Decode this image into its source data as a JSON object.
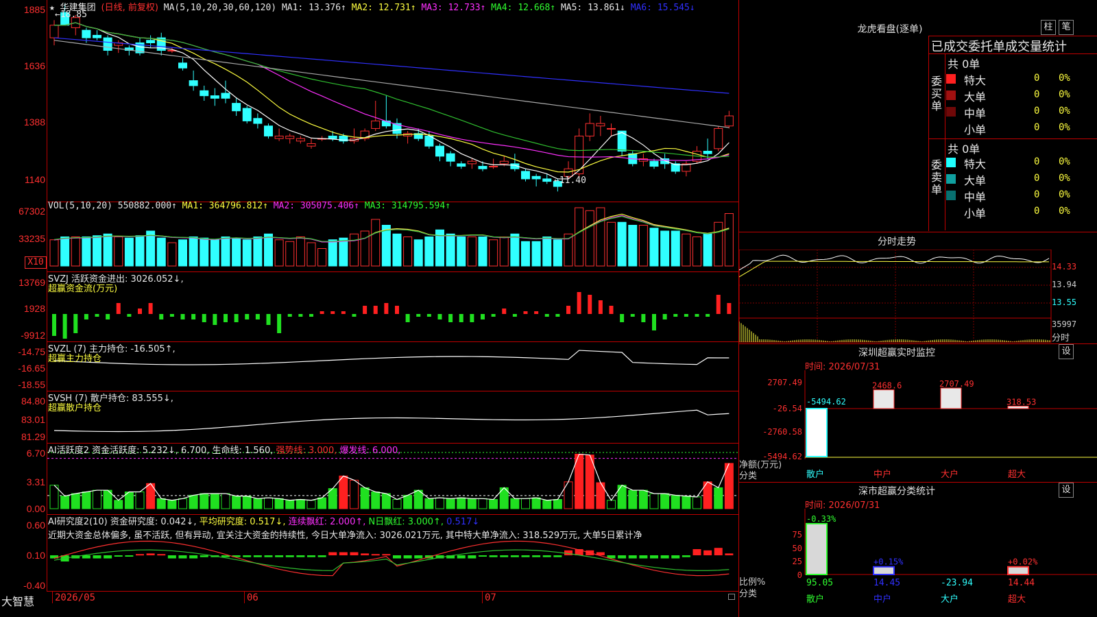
{
  "app": {
    "brand": "大智慧",
    "lock_icon": "lock-icon"
  },
  "kline": {
    "star": "★",
    "stock_name": "华建集团",
    "mode": "(日线, 前复权)",
    "ma_params": "MA(5,10,20,30,60,120)",
    "ma1": "MA1: 13.376↑",
    "ma2": "MA2: 12.731↑",
    "ma3": "MA3: 12.733↑",
    "ma4": "MA4: 12.668↑",
    "ma5": "MA5: 13.861↓",
    "ma6": "MA6: 15.545↓",
    "high_label": "18.85",
    "low_label": "11.40",
    "yticks": [
      "1885",
      "1636",
      "1388",
      "1140"
    ]
  },
  "vol": {
    "title": "VOL(5,10,20)",
    "value": "550882.000↑",
    "ma1": "MA1: 364796.812↑",
    "ma2": "MA2: 305075.406↑",
    "ma3": "MA3: 314795.594↑",
    "yticks": [
      "67302",
      "33235"
    ],
    "unit": "X10"
  },
  "svzj": {
    "title": "SVZJ  活跃资金进出: 3026.052↓,",
    "subtitle": "超赢资金流(万元)",
    "yticks": [
      "13769",
      "1928",
      "-9912"
    ]
  },
  "svzl": {
    "title": "SVZL (7) 主力持仓: -16.505↑,",
    "subtitle": "超赢主力持仓",
    "yticks": [
      "-14.75",
      "-16.65",
      "-18.55"
    ]
  },
  "svsh": {
    "title": "SVSH (7) 散户持仓: 83.555↓,",
    "subtitle": "超赢散户持仓",
    "yticks": [
      "84.80",
      "83.01",
      "81.29"
    ]
  },
  "ai1": {
    "title": "AI活跃度2 资金活跃度: 5.232↓, 6.700, 生命线: 1.560,",
    "strong": "强势线: 3.000,",
    "burst": "爆发线: 6.000,",
    "yticks": [
      "6.70",
      "3.31",
      "0.00"
    ]
  },
  "ai2": {
    "title_a": "AI研究度2(10) 资金研究度: 0.042↓,",
    "title_b": "平均研究度: 0.517↓,",
    "title_c": "连续飘红: 2.000↑,",
    "title_d": "N日飘红: 3.000↑,",
    "title_e": "0.517↓",
    "comment": "近期大资金总体偏多, 虽不活跃, 但有异动, 宜关注大资金的持续性, 今日大单净流入: 3026.021万元, 其中特大单净流入: 318.529万元, 大单5日累计净",
    "yticks": [
      "0.60",
      "0.10",
      "-0.40"
    ]
  },
  "xaxis": {
    "labels": [
      "2026/05",
      "06",
      "07"
    ]
  },
  "lhb": {
    "title": "龙虎看盘(逐单)",
    "btn1": "柱",
    "btn2": "笔",
    "header": "已成交委托单成交量统计",
    "buy_label": "委买单",
    "sell_label": "委卖单",
    "buy_total": "共 0单",
    "sell_total": "共 0单",
    "buy_rows": [
      {
        "name": "特大",
        "count": "0",
        "pct": "0%",
        "color": "#ff2020"
      },
      {
        "name": "大单",
        "count": "0",
        "pct": "0%",
        "color": "#a01010"
      },
      {
        "name": "中单",
        "count": "0",
        "pct": "0%",
        "color": "#700808"
      },
      {
        "name": "小单",
        "count": "0",
        "pct": "0%",
        "color": "#000000"
      }
    ],
    "sell_rows": [
      {
        "name": "特大",
        "count": "0",
        "pct": "0%",
        "color": "#20ffff"
      },
      {
        "name": "大单",
        "count": "0",
        "pct": "0%",
        "color": "#10a0a0"
      },
      {
        "name": "中单",
        "count": "0",
        "pct": "0%",
        "color": "#087070"
      },
      {
        "name": "小单",
        "count": "0",
        "pct": "0%",
        "color": "#000000"
      }
    ]
  },
  "fenshi": {
    "title": "分时走势",
    "yticks": [
      "14.33",
      "13.94",
      "13.55"
    ],
    "vol_label": "35997",
    "tag": "分时"
  },
  "szmon": {
    "title": "深圳超赢实时监控",
    "set_btn": "设",
    "time": "时间: 2026/07/31",
    "yticks": [
      "2707.49",
      "-26.54",
      "-2760.58",
      "-5494.62"
    ],
    "ylabel": "净额(万元)",
    "xlabel": "分类",
    "bars": [
      {
        "name": "散户",
        "value": -5494.62,
        "label": "-5494.62"
      },
      {
        "name": "中户",
        "value": 2468.6,
        "label": "2468.6"
      },
      {
        "name": "大户",
        "value": 2707.49,
        "label": "2707.49"
      },
      {
        "name": "超大",
        "value": 318.53,
        "label": "318.53"
      }
    ]
  },
  "szcls": {
    "title": "深市超赢分类统计",
    "set_btn": "设",
    "time": "时间: 2026/07/31",
    "yticks": [
      "75",
      "50",
      "25",
      "0"
    ],
    "ylabel": "比例%",
    "xlabel": "分类",
    "bars": [
      {
        "name": "散户",
        "ratio": 95.05,
        "change": "-0.33%",
        "value": "95.05"
      },
      {
        "name": "中户",
        "ratio": 14.45,
        "change": "+0.15%",
        "value": "14.45"
      },
      {
        "name": "大户",
        "ratio": 0,
        "change": "",
        "value": "-23.94"
      },
      {
        "name": "超大",
        "ratio": 14.44,
        "change": "+0.02%",
        "value": "14.44"
      }
    ]
  },
  "chart_data": {
    "type": "candlestick",
    "candles": [
      [
        17.5,
        18.2,
        18.0,
        17.2
      ],
      [
        18.5,
        18.85,
        18.0,
        18.4
      ],
      [
        17.9,
        18.4,
        18.3,
        17.6
      ],
      [
        17.8,
        17.9,
        17.5,
        17.3
      ],
      [
        17.6,
        17.8,
        17.5,
        17.4
      ],
      [
        17.5,
        17.6,
        17.0,
        16.8
      ],
      [
        17.2,
        17.4,
        17.3,
        16.9
      ],
      [
        17.1,
        17.2,
        17.0,
        16.8
      ],
      [
        17.3,
        17.5,
        16.9,
        16.8
      ],
      [
        17.4,
        17.6,
        17.3,
        17.1
      ],
      [
        17.5,
        17.7,
        17.0,
        16.8
      ],
      [
        17.0,
        17.1,
        17.0,
        16.9
      ],
      [
        16.5,
        16.7,
        16.3,
        16.2
      ],
      [
        15.8,
        16.2,
        15.6,
        15.4
      ],
      [
        15.4,
        15.6,
        15.2,
        15.0
      ],
      [
        15.2,
        15.5,
        15.1,
        14.8
      ],
      [
        15.3,
        15.8,
        15.1,
        14.9
      ],
      [
        14.9,
        15.1,
        14.6,
        14.4
      ],
      [
        14.7,
        14.8,
        14.2,
        14.1
      ],
      [
        14.3,
        14.5,
        14.1,
        13.9
      ],
      [
        14.0,
        14.1,
        13.6,
        13.5
      ],
      [
        13.5,
        13.9,
        13.6,
        13.4
      ],
      [
        13.5,
        13.7,
        13.6,
        13.3
      ],
      [
        13.4,
        13.6,
        13.5,
        13.3
      ],
      [
        13.2,
        13.5,
        13.3,
        13.1
      ],
      [
        13.5,
        13.6,
        13.5,
        13.4
      ],
      [
        13.6,
        13.8,
        13.5,
        13.4
      ],
      [
        13.6,
        13.7,
        13.4,
        13.3
      ],
      [
        13.4,
        13.9,
        13.5,
        13.3
      ],
      [
        13.5,
        13.9,
        13.8,
        13.4
      ],
      [
        13.9,
        15.0,
        14.2,
        13.8
      ],
      [
        14.2,
        15.2,
        14.0,
        13.9
      ],
      [
        14.1,
        14.3,
        13.7,
        13.5
      ],
      [
        13.6,
        13.8,
        13.7,
        13.3
      ],
      [
        13.7,
        13.9,
        13.5,
        13.4
      ],
      [
        13.6,
        13.8,
        13.2,
        13.1
      ],
      [
        13.2,
        13.3,
        12.8,
        12.6
      ],
      [
        12.9,
        13.0,
        12.6,
        12.4
      ],
      [
        12.5,
        12.6,
        12.4,
        12.3
      ],
      [
        12.5,
        12.7,
        12.6,
        12.3
      ],
      [
        12.4,
        12.6,
        12.3,
        12.2
      ],
      [
        12.4,
        12.7,
        12.4,
        12.3
      ],
      [
        12.5,
        12.8,
        12.6,
        12.4
      ],
      [
        12.5,
        12.9,
        12.3,
        12.2
      ],
      [
        12.2,
        12.3,
        11.9,
        11.8
      ],
      [
        12.0,
        12.1,
        11.9,
        11.6
      ],
      [
        11.9,
        12.1,
        11.8,
        11.7
      ],
      [
        11.8,
        11.9,
        11.6,
        11.4
      ],
      [
        12.0,
        12.6,
        12.3,
        11.9
      ],
      [
        12.1,
        13.9,
        13.6,
        11.9
      ],
      [
        13.6,
        14.5,
        14.1,
        13.4
      ],
      [
        14.0,
        14.4,
        14.1,
        13.6
      ],
      [
        13.9,
        14.1,
        13.9,
        13.6
      ],
      [
        13.8,
        13.8,
        13.0,
        12.8
      ],
      [
        12.9,
        13.0,
        12.5,
        12.4
      ],
      [
        12.6,
        12.9,
        12.7,
        12.4
      ],
      [
        12.6,
        12.7,
        12.4,
        12.3
      ],
      [
        12.7,
        12.9,
        12.5,
        12.3
      ],
      [
        12.5,
        12.6,
        12.2,
        12.1
      ],
      [
        12.2,
        12.6,
        12.5,
        12.0
      ],
      [
        12.6,
        13.2,
        13.0,
        12.5
      ],
      [
        13.0,
        13.5,
        12.9,
        12.7
      ],
      [
        13.1,
        14.0,
        13.9,
        13.0
      ],
      [
        14.0,
        14.6,
        14.4,
        13.9
      ]
    ],
    "ylim": [
      11.0,
      19.0
    ]
  }
}
